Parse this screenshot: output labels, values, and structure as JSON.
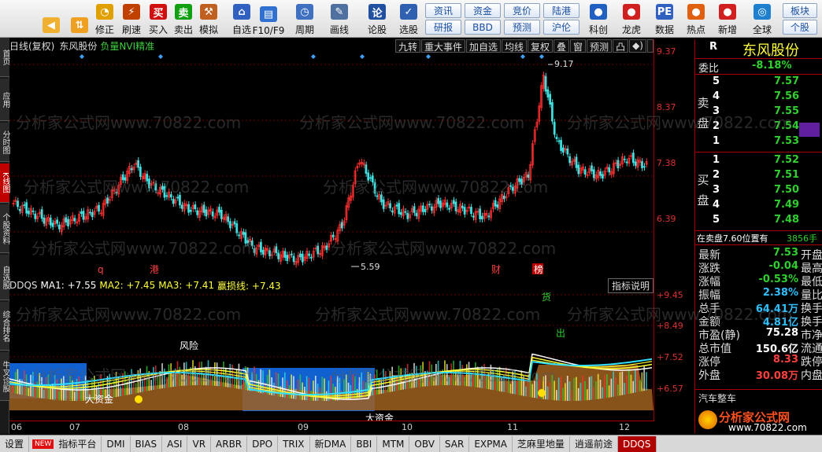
{
  "toolbar": {
    "main_buttons": [
      {
        "label": "",
        "icon": "back-arrow-icon",
        "color": "#f0b030"
      },
      {
        "label": "",
        "icon": "up-down-arrow-icon",
        "color": "#f0a020"
      },
      {
        "label": "修正",
        "icon": "clock-icon",
        "color": "#e0a000"
      },
      {
        "label": "刷速",
        "icon": "flash-icon",
        "color": "#c04000"
      },
      {
        "label": "买入",
        "icon": "buy-icon",
        "color": "#d01010",
        "glyph": "买"
      },
      {
        "label": "卖出",
        "icon": "sell-icon",
        "color": "#10a010",
        "glyph": "卖"
      },
      {
        "label": "模拟",
        "icon": "hammer-icon",
        "color": "#c06020"
      },
      {
        "label": "自选",
        "icon": "house-icon",
        "color": "#3060c0"
      },
      {
        "label": "F10/F9",
        "icon": "table-icon",
        "color": "#3070d0"
      },
      {
        "label": "周期",
        "icon": "cycle-icon",
        "color": "#4070c0"
      },
      {
        "label": "画线",
        "icon": "pencil-icon",
        "color": "#5070a0"
      },
      {
        "label": "论股",
        "icon": "discuss-icon",
        "color": "#2050a0",
        "glyph": "论"
      },
      {
        "label": "选股",
        "icon": "select-icon",
        "color": "#3060b0"
      }
    ],
    "quick_buttons": [
      "资讯",
      "资金",
      "竞价",
      "陆港",
      "研报",
      "BBD",
      "预测",
      "沪伦"
    ],
    "right_buttons": [
      {
        "label": "科创",
        "icon": "science-icon"
      },
      {
        "label": "龙虎",
        "icon": "dragon-icon"
      },
      {
        "label": "数据",
        "icon": "pe-icon"
      },
      {
        "label": "热点",
        "icon": "hot-icon"
      },
      {
        "label": "新增",
        "icon": "news-icon"
      },
      {
        "label": "全球",
        "icon": "globe-icon"
      }
    ],
    "far_right": [
      "板块",
      "个股"
    ]
  },
  "sidebar": [
    "首页",
    "应用",
    "分时图",
    "K线图",
    "个股资料",
    "自选股",
    "综合排名",
    "牛叉诊股"
  ],
  "main": {
    "period_label": "日线(复权)",
    "stock_name": "东风股份",
    "indicator_name": "负量NVI精准",
    "tools": [
      "九转",
      "重大事件",
      "加自选",
      "均线",
      "复权",
      "叠",
      "窗",
      "预测",
      "凸",
      "◆)",
      ""
    ],
    "markers": [
      "q",
      "港",
      "财",
      "榜"
    ],
    "high_label": "9.17",
    "low_label": "5.59"
  },
  "yaxis_main": [
    "9.37",
    "8.37",
    "7.38",
    "6.39"
  ],
  "yaxis_ind": [
    "+9.45",
    "+8.49",
    "+7.52",
    "+6.57"
  ],
  "indicator": {
    "name": "DDQS",
    "ma1": "MA1: +7.55",
    "ma2": "MA2: +7.45",
    "ma3": "MA3: +7.41",
    "line": "赢损线: +7.43",
    "explain": "指标说明",
    "annotations": [
      "风险",
      "大资金",
      "大资金",
      "货",
      "出"
    ]
  },
  "xaxis": [
    "06",
    "07",
    "08",
    "09",
    "10",
    "11",
    "12"
  ],
  "quote": {
    "code": "R",
    "name": "东风股份",
    "wb_label": "委比",
    "wb_value": "-8.18%",
    "sell_label": "卖盘",
    "buy_label": "买盘",
    "sell": [
      {
        "n": "5",
        "p": "7.57"
      },
      {
        "n": "4",
        "p": "7.56"
      },
      {
        "n": "3",
        "p": "7.55"
      },
      {
        "n": "2",
        "p": "7.54"
      },
      {
        "n": "1",
        "p": "7.53"
      }
    ],
    "buy": [
      {
        "n": "1",
        "p": "7.52"
      },
      {
        "n": "2",
        "p": "7.51"
      },
      {
        "n": "3",
        "p": "7.50"
      },
      {
        "n": "4",
        "p": "7.49"
      },
      {
        "n": "5",
        "p": "7.48"
      }
    ],
    "position": "在卖盘7.60位置有",
    "position_vol": "3856手",
    "stats": [
      {
        "k": "最新",
        "v": "7.53",
        "k2": "开盘",
        "c": "#30d030"
      },
      {
        "k": "涨跌",
        "v": "-0.04",
        "k2": "最高",
        "c": "#30d030"
      },
      {
        "k": "涨幅",
        "v": "-0.53%",
        "k2": "最低",
        "c": "#30d030"
      },
      {
        "k": "振幅",
        "v": "2.38%",
        "k2": "量比",
        "c": "#30c0ff"
      },
      {
        "k": "总手",
        "v": "64.41万",
        "k2": "换手",
        "c": "#30c0ff"
      },
      {
        "k": "金额",
        "v": "4.81亿",
        "k2": "换手",
        "c": "#30c0ff"
      },
      {
        "k": "市盈(静)",
        "v": "75.28",
        "k2": "市净",
        "c": "#ffffff"
      },
      {
        "k": "总市值",
        "v": "150.6亿",
        "k2": "流通",
        "c": "#ffffff"
      },
      {
        "k": "涨停",
        "v": "8.33",
        "k2": "跌停",
        "c": "#ff4040"
      },
      {
        "k": "外盘",
        "v": "30.08万",
        "k2": "内盘",
        "c": "#ff4040"
      }
    ],
    "industry": "汽车整车",
    "logo_cn": "分析家公式网",
    "logo_url": "www.70822.com"
  },
  "bottom_tabs": [
    "设置",
    "NEW",
    "指标平台",
    "DMI",
    "BIAS",
    "ASI",
    "VR",
    "ARBR",
    "DPO",
    "TRIX",
    "新DMA",
    "BBI",
    "MTM",
    "OBV",
    "SAR",
    "EXPMA",
    "芝麻里地量",
    "逍遥前途",
    "DDQS"
  ],
  "watermark": "分析家公式网www.70822.com"
}
